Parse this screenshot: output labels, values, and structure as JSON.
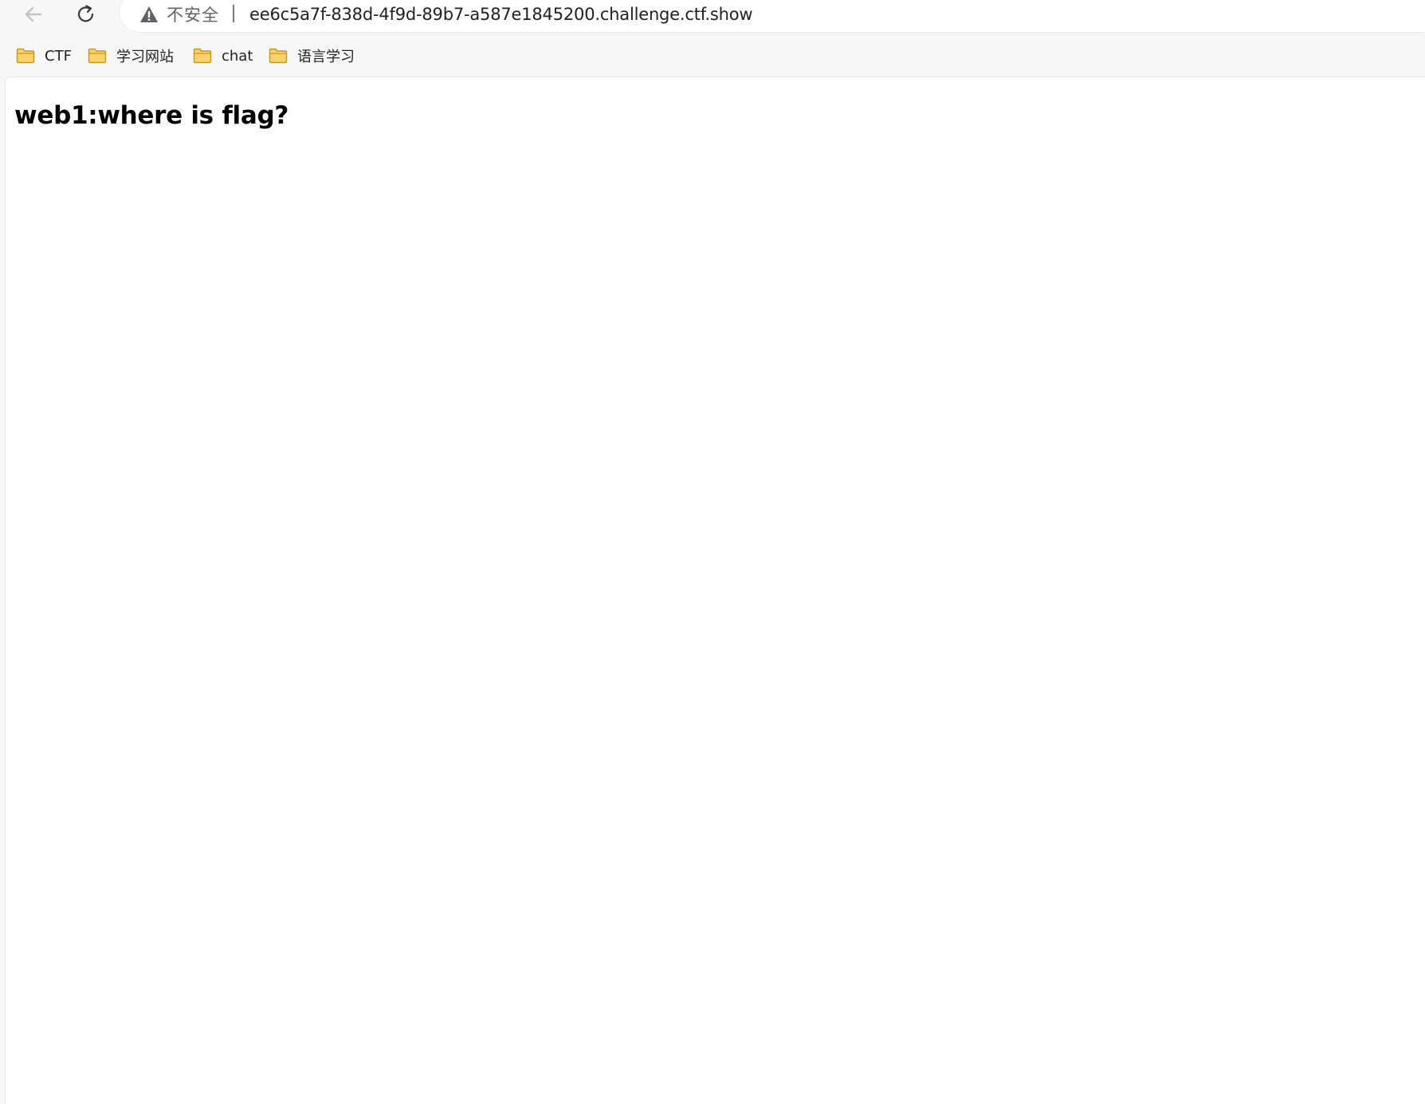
{
  "toolbar": {
    "back_icon": "arrow-left-icon",
    "reload_icon": "reload-icon",
    "security_icon": "warning-icon",
    "security_label": "不安全",
    "url": "ee6c5a7f-838d-4f9d-89b7-a587e1845200.challenge.ctf.show"
  },
  "bookmarks": [
    {
      "label": "CTF",
      "icon": "folder-icon"
    },
    {
      "label": "学习网站",
      "icon": "folder-icon"
    },
    {
      "label": "chat",
      "icon": "folder-icon"
    },
    {
      "label": "语言学习",
      "icon": "folder-icon"
    }
  ],
  "page": {
    "heading": "web1:where is flag?"
  },
  "colors": {
    "folder_fill": "#f9d26b",
    "folder_stroke": "#c79a16",
    "warning": "#5f6368"
  }
}
